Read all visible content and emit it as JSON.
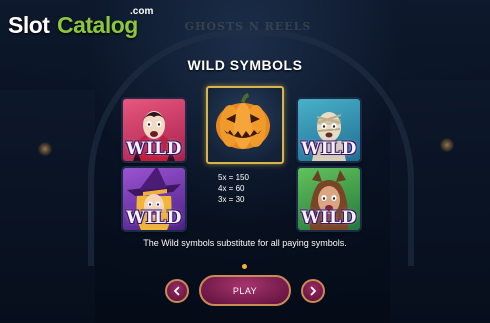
{
  "watermark": {
    "slot": "Slot",
    "catalog": "Catalog",
    "com": ".com"
  },
  "game_title": "GHOSTS N REELS",
  "heading": "WILD SYMBOLS",
  "symbols": {
    "vampire": {
      "label": "WILD"
    },
    "witch": {
      "label": "WILD"
    },
    "mummy": {
      "label": "WILD"
    },
    "werewolf": {
      "label": "WILD"
    },
    "pumpkin": {
      "icon": "jack-o-lantern"
    }
  },
  "payouts": [
    "5x = 150",
    "4x = 60",
    "3x = 30"
  ],
  "description": "The Wild symbols substitute for all paying symbols.",
  "controls": {
    "prev_icon": "chevron-left",
    "play_label": "PLAY",
    "next_icon": "chevron-right"
  },
  "pagination": {
    "active_page": 1
  },
  "colors": {
    "accent_green": "#8cc63f",
    "button": "#8a2256",
    "border_gold": "#d9b44a",
    "page_dot": "#f2b33a"
  }
}
